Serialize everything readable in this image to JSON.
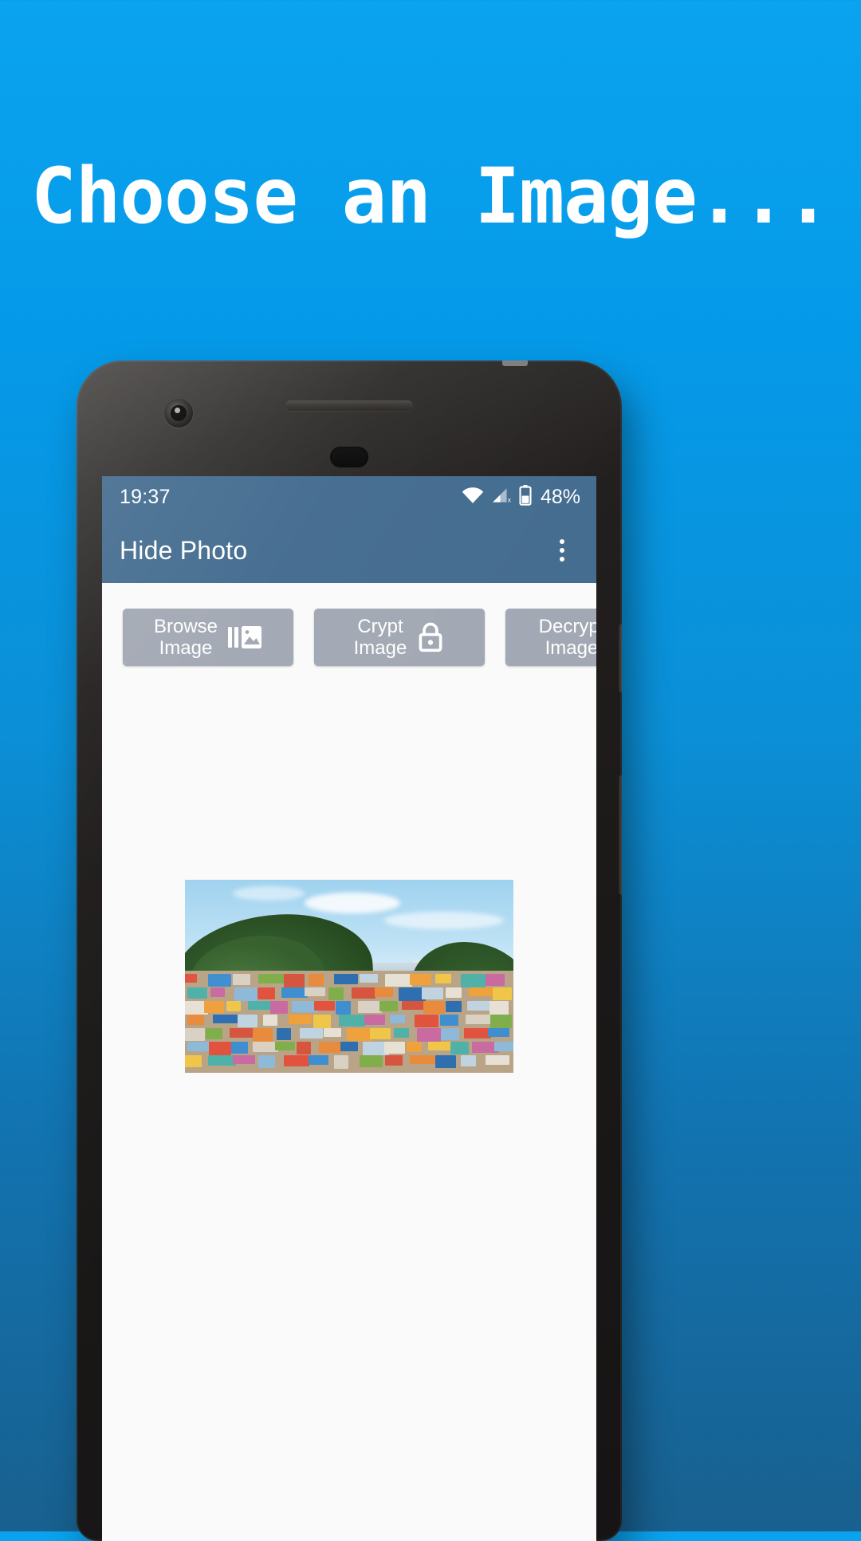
{
  "promo": {
    "headline": "Choose an Image...",
    "background_top_color": "#0aa3ef",
    "background_bottom_color": "#18608f"
  },
  "device": {
    "name": "android-phone-mockup",
    "camera_icon": "front-camera-icon",
    "speaker_icon": "earpiece-speaker-icon",
    "sensor_icon": "proximity-sensor-icon"
  },
  "app": {
    "accent_color": "#456d90",
    "button_color": "#a3a9b4",
    "screen_background": "#fafafa",
    "statusbar": {
      "time": "19:37",
      "wifi_icon": "wifi-icon",
      "signal_icon": "cellular-signal-icon",
      "battery_icon": "battery-icon",
      "battery_text": "48%"
    },
    "toolbar": {
      "title": "Hide Photo",
      "overflow_icon": "overflow-menu-icon"
    },
    "buttons": [
      {
        "label": "Browse\nImage",
        "icon": "photo-library-icon",
        "name": "browse-image-button"
      },
      {
        "label": "Crypt\nImage",
        "icon": "lock-closed-icon",
        "name": "crypt-image-button"
      },
      {
        "label": "Decrypt\nImage",
        "icon": "lock-open-icon",
        "name": "decrypt-image-button"
      }
    ],
    "preview": {
      "alt": "colorful hillside village photo thumbnail",
      "name": "image-preview"
    }
  }
}
